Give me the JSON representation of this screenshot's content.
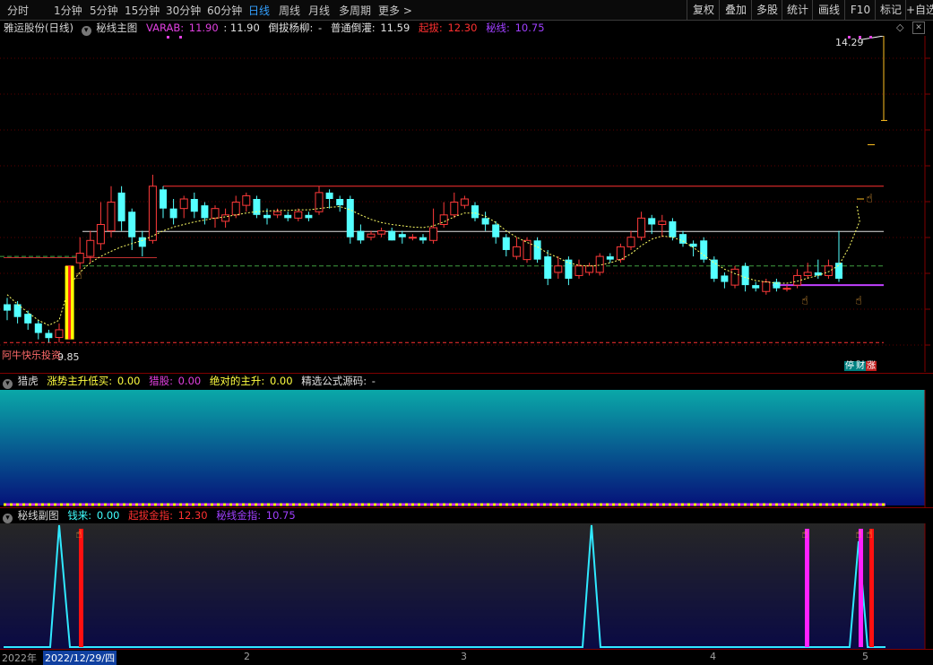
{
  "toolbar": {
    "timeframes": [
      "分时",
      "1分钟",
      "5分钟",
      "15分钟",
      "30分钟",
      "60分钟",
      "日线",
      "周线",
      "月线",
      "多周期",
      "更多 >"
    ],
    "active_timeframe": "日线",
    "tools": [
      "复权",
      "叠加",
      "多股",
      "统计",
      "画线",
      "F10",
      "标记",
      "+自选"
    ]
  },
  "main_panel": {
    "stock_title": "雅运股份(日线)",
    "indicator_name": "秘线主图",
    "varab_label": "VARAB:",
    "varab_value": "11.90",
    "varab_value2": ": 11.90",
    "daoba_label": "倒拔杨柳:",
    "daoba_value": "-",
    "putong_label": "普通倒灌:",
    "putong_value": "11.59",
    "qiba_label": "起拔:",
    "qiba_value": "12.30",
    "mixian_label": "秘线:",
    "mixian_value": "10.75",
    "high_label": "14.29",
    "low_label": "9.85",
    "watermark": "阿牛快乐投资",
    "badge_ting": "停",
    "badge_cai": "财",
    "badge_zhang": "涨",
    "colors": {
      "up": "#ff3a3a",
      "down": "#54ffff",
      "ma": "#ffff66",
      "white_line": "#e0e0e0",
      "red_line": "#ff3030",
      "green_dash": "#40a040",
      "purple": "#c040ff"
    }
  },
  "panel2": {
    "indicator_name": "猎虎",
    "f1_label": "涨势主升低买:",
    "f1_value": "0.00",
    "f2_label": "猎股:",
    "f2_value": "0.00",
    "f3_label": "绝对的主升:",
    "f3_value": "0.00",
    "f4_label": "精选公式源码:",
    "f4_value": "-"
  },
  "panel3": {
    "indicator_name": "秘线副图",
    "f1_label": "钱来:",
    "f1_value": "0.00",
    "f2_label": "起拔金指:",
    "f2_value": "12.30",
    "f3_label": "秘线金指:",
    "f3_value": "10.75"
  },
  "xaxis": {
    "labels": [
      "2022年",
      "2022/12/29/四",
      "2",
      "3",
      "4",
      "5"
    ]
  },
  "chart_data": {
    "type": "candlestick",
    "unit": "price (CNY)",
    "ylim": [
      9.6,
      14.6
    ],
    "candles": [
      {
        "o": 10.45,
        "c": 10.35,
        "h": 10.55,
        "l": 10.2
      },
      {
        "o": 10.45,
        "c": 10.25,
        "h": 10.5,
        "l": 10.15
      },
      {
        "o": 10.3,
        "c": 10.15,
        "h": 10.35,
        "l": 10.05
      },
      {
        "o": 10.15,
        "c": 10.0,
        "h": 10.2,
        "l": 9.9
      },
      {
        "o": 10.0,
        "c": 9.92,
        "h": 10.05,
        "l": 9.85
      },
      {
        "o": 9.93,
        "c": 10.05,
        "h": 10.15,
        "l": 9.85
      },
      {
        "o": 10.0,
        "c": 11.05,
        "h": 11.05,
        "l": 10.0
      },
      {
        "o": 11.1,
        "c": 11.25,
        "h": 11.5,
        "l": 11.0
      },
      {
        "o": 11.2,
        "c": 11.45,
        "h": 11.6,
        "l": 11.1
      },
      {
        "o": 11.4,
        "c": 11.7,
        "h": 12.05,
        "l": 11.3
      },
      {
        "o": 11.6,
        "c": 12.05,
        "h": 12.3,
        "l": 11.5
      },
      {
        "o": 12.2,
        "c": 11.75,
        "h": 12.3,
        "l": 11.6
      },
      {
        "o": 11.9,
        "c": 11.5,
        "h": 11.95,
        "l": 11.3
      },
      {
        "o": 11.5,
        "c": 11.35,
        "h": 11.6,
        "l": 11.2
      },
      {
        "o": 11.45,
        "c": 12.3,
        "h": 12.48,
        "l": 11.4
      },
      {
        "o": 12.25,
        "c": 11.95,
        "h": 12.3,
        "l": 11.8
      },
      {
        "o": 11.95,
        "c": 11.8,
        "h": 12.1,
        "l": 11.7
      },
      {
        "o": 11.95,
        "c": 12.1,
        "h": 12.15,
        "l": 11.8
      },
      {
        "o": 12.1,
        "c": 11.9,
        "h": 12.2,
        "l": 11.8
      },
      {
        "o": 12.0,
        "c": 11.8,
        "h": 12.05,
        "l": 11.7
      },
      {
        "o": 11.8,
        "c": 11.95,
        "h": 12.0,
        "l": 11.65
      },
      {
        "o": 11.75,
        "c": 11.85,
        "h": 11.95,
        "l": 11.65
      },
      {
        "o": 11.85,
        "c": 12.05,
        "h": 12.15,
        "l": 11.8
      },
      {
        "o": 12.0,
        "c": 12.15,
        "h": 12.2,
        "l": 11.9
      },
      {
        "o": 12.1,
        "c": 11.85,
        "h": 12.15,
        "l": 11.8
      },
      {
        "o": 11.85,
        "c": 11.8,
        "h": 11.95,
        "l": 11.7
      },
      {
        "o": 11.85,
        "c": 11.9,
        "h": 11.95,
        "l": 11.8
      },
      {
        "o": 11.85,
        "c": 11.8,
        "h": 11.9,
        "l": 11.75
      },
      {
        "o": 11.8,
        "c": 11.9,
        "h": 11.95,
        "l": 11.75
      },
      {
        "o": 11.85,
        "c": 11.8,
        "h": 11.9,
        "l": 11.75
      },
      {
        "o": 11.9,
        "c": 12.2,
        "h": 12.3,
        "l": 11.85
      },
      {
        "o": 12.2,
        "c": 12.1,
        "h": 12.25,
        "l": 11.95
      },
      {
        "o": 12.1,
        "c": 12.0,
        "h": 12.15,
        "l": 11.9
      },
      {
        "o": 12.1,
        "c": 11.5,
        "h": 12.15,
        "l": 11.4
      },
      {
        "o": 11.6,
        "c": 11.45,
        "h": 11.7,
        "l": 11.4
      },
      {
        "o": 11.5,
        "c": 11.55,
        "h": 11.6,
        "l": 11.45
      },
      {
        "o": 11.55,
        "c": 11.6,
        "h": 11.65,
        "l": 11.5
      },
      {
        "o": 11.6,
        "c": 11.45,
        "h": 11.65,
        "l": 11.45
      },
      {
        "o": 11.55,
        "c": 11.5,
        "h": 11.6,
        "l": 11.4
      },
      {
        "o": 11.5,
        "c": 11.5,
        "h": 11.55,
        "l": 11.45
      },
      {
        "o": 11.5,
        "c": 11.45,
        "h": 11.55,
        "l": 11.4
      },
      {
        "o": 11.45,
        "c": 11.65,
        "h": 11.95,
        "l": 11.4
      },
      {
        "o": 11.7,
        "c": 11.85,
        "h": 12.05,
        "l": 11.65
      },
      {
        "o": 11.85,
        "c": 12.05,
        "h": 12.2,
        "l": 11.8
      },
      {
        "o": 12.0,
        "c": 12.1,
        "h": 12.15,
        "l": 11.95
      },
      {
        "o": 12.0,
        "c": 11.8,
        "h": 12.05,
        "l": 11.75
      },
      {
        "o": 11.8,
        "c": 11.7,
        "h": 11.9,
        "l": 11.6
      },
      {
        "o": 11.7,
        "c": 11.5,
        "h": 11.75,
        "l": 11.4
      },
      {
        "o": 11.5,
        "c": 11.3,
        "h": 11.55,
        "l": 11.2
      },
      {
        "o": 11.2,
        "c": 11.35,
        "h": 11.5,
        "l": 11.15
      },
      {
        "o": 11.15,
        "c": 11.45,
        "h": 11.5,
        "l": 11.1
      },
      {
        "o": 11.45,
        "c": 11.15,
        "h": 11.5,
        "l": 11.1
      },
      {
        "o": 11.2,
        "c": 10.85,
        "h": 11.3,
        "l": 10.75
      },
      {
        "o": 10.95,
        "c": 11.05,
        "h": 11.2,
        "l": 10.85
      },
      {
        "o": 11.15,
        "c": 10.85,
        "h": 11.2,
        "l": 10.75
      },
      {
        "o": 10.9,
        "c": 11.05,
        "h": 11.15,
        "l": 10.85
      },
      {
        "o": 10.95,
        "c": 11.05,
        "h": 11.1,
        "l": 10.9
      },
      {
        "o": 10.95,
        "c": 11.2,
        "h": 11.25,
        "l": 10.9
      },
      {
        "o": 11.2,
        "c": 11.15,
        "h": 11.25,
        "l": 11.1
      },
      {
        "o": 11.15,
        "c": 11.35,
        "h": 11.4,
        "l": 11.1
      },
      {
        "o": 11.35,
        "c": 11.5,
        "h": 11.6,
        "l": 11.3
      },
      {
        "o": 11.5,
        "c": 11.8,
        "h": 11.9,
        "l": 11.45
      },
      {
        "o": 11.8,
        "c": 11.7,
        "h": 11.85,
        "l": 11.55
      },
      {
        "o": 11.7,
        "c": 11.75,
        "h": 11.85,
        "l": 11.5
      },
      {
        "o": 11.75,
        "c": 11.5,
        "h": 11.8,
        "l": 11.45
      },
      {
        "o": 11.55,
        "c": 11.4,
        "h": 11.6,
        "l": 11.35
      },
      {
        "o": 11.4,
        "c": 11.35,
        "h": 11.45,
        "l": 11.2
      },
      {
        "o": 11.45,
        "c": 11.15,
        "h": 11.5,
        "l": 11.1
      },
      {
        "o": 11.15,
        "c": 10.85,
        "h": 11.2,
        "l": 10.8
      },
      {
        "o": 10.9,
        "c": 10.8,
        "h": 10.95,
        "l": 10.7
      },
      {
        "o": 10.75,
        "c": 11.0,
        "h": 11.05,
        "l": 10.7
      },
      {
        "o": 11.05,
        "c": 10.75,
        "h": 11.1,
        "l": 10.65
      },
      {
        "o": 10.75,
        "c": 10.7,
        "h": 10.8,
        "l": 10.65
      },
      {
        "o": 10.65,
        "c": 10.8,
        "h": 10.85,
        "l": 10.6
      },
      {
        "o": 10.8,
        "c": 10.7,
        "h": 10.85,
        "l": 10.65
      },
      {
        "o": 10.7,
        "c": 10.7,
        "h": 10.75,
        "l": 10.65
      },
      {
        "o": 10.75,
        "c": 10.9,
        "h": 11.0,
        "l": 10.7
      },
      {
        "o": 10.9,
        "c": 10.95,
        "h": 11.1,
        "l": 10.85
      },
      {
        "o": 10.95,
        "c": 10.9,
        "h": 11.15,
        "l": 10.85
      },
      {
        "o": 10.9,
        "c": 11.05,
        "h": 11.15,
        "l": 10.85
      },
      {
        "o": 11.1,
        "c": 10.85,
        "h": 11.6,
        "l": 10.8
      }
    ],
    "ma": [
      10.6,
      10.45,
      10.32,
      10.2,
      10.12,
      10.2,
      10.75,
      10.95,
      11.1,
      11.2,
      11.28,
      11.35,
      11.4,
      11.45,
      11.52,
      11.6,
      11.66,
      11.7,
      11.74,
      11.77,
      11.8,
      11.82,
      11.85,
      11.88,
      11.9,
      11.91,
      11.92,
      11.92,
      11.93,
      11.93,
      11.95,
      11.97,
      11.98,
      11.93,
      11.85,
      11.78,
      11.73,
      11.7,
      11.68,
      11.66,
      11.65,
      11.68,
      11.74,
      11.82,
      11.88,
      11.88,
      11.83,
      11.73,
      11.6,
      11.5,
      11.42,
      11.35,
      11.25,
      11.18,
      11.1,
      11.06,
      11.05,
      11.06,
      11.1,
      11.15,
      11.24,
      11.37,
      11.47,
      11.52,
      11.5,
      11.44,
      11.34,
      11.22,
      11.1,
      11.0,
      10.93,
      10.87,
      10.82,
      10.8,
      10.78,
      10.78,
      10.81,
      10.86,
      10.9,
      10.96,
      11.06,
      11.35,
      11.75
    ],
    "levels": {
      "red_top": 12.3,
      "white_mid": 11.59,
      "green_dash_1": 11.2,
      "green_dash_2": 11.05,
      "red_bottom_dash": 9.85,
      "purple": 10.75,
      "high_mark": 14.29
    }
  }
}
